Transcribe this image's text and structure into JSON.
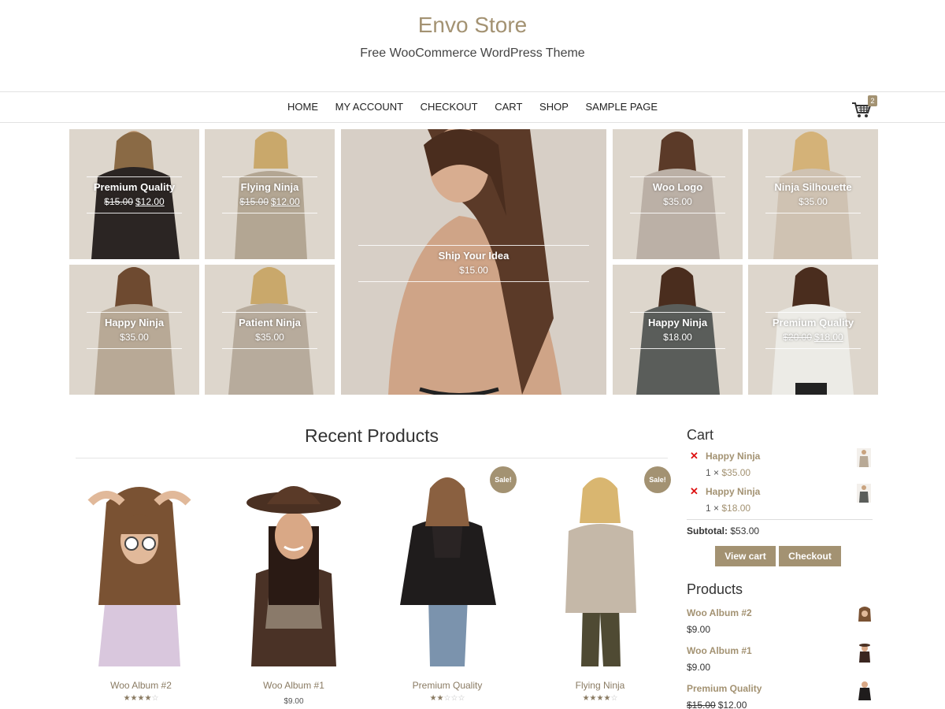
{
  "site": {
    "title": "Envo Store",
    "tagline": "Free WooCommerce WordPress Theme"
  },
  "nav": {
    "items": [
      "HOME",
      "MY ACCOUNT",
      "CHECKOUT",
      "CART",
      "SHOP",
      "SAMPLE PAGE"
    ],
    "cart_count": "2",
    "cart_icon": "shopping-cart-icon"
  },
  "grid": [
    {
      "name": "Premium Quality",
      "old_price": "$15.00",
      "price": "$12.00",
      "dark": true
    },
    {
      "name": "Flying Ninja",
      "old_price": "$15.00",
      "price": "$12.00"
    },
    {
      "name": "Ship Your Idea",
      "price": "$15.00"
    },
    {
      "name": "Woo Logo",
      "price": "$35.00"
    },
    {
      "name": "Ninja Silhouette",
      "price": "$35.00"
    },
    {
      "name": "Happy Ninja",
      "price": "$35.00"
    },
    {
      "name": "Patient Ninja",
      "price": "$35.00"
    },
    {
      "name": "Happy Ninja",
      "price": "$18.00",
      "dark": true
    },
    {
      "name": "Premium Quality",
      "old_price": "$20.00",
      "price": "$18.00"
    }
  ],
  "recent": {
    "title": "Recent Products",
    "products": [
      {
        "name": "Woo Album #2",
        "rating": 4,
        "sale": false
      },
      {
        "name": "Woo Album #1",
        "price": "$9.00",
        "sale": false
      },
      {
        "name": "Premium Quality",
        "rating": 2,
        "sale": true
      },
      {
        "name": "Flying Ninja",
        "rating": 4,
        "sale": true
      }
    ],
    "sale_label": "Sale!"
  },
  "cart_widget": {
    "title": "Cart",
    "items": [
      {
        "name": "Happy Ninja",
        "qty": "1 ×",
        "price": "$35.00"
      },
      {
        "name": "Happy Ninja",
        "qty": "1 ×",
        "price": "$18.00"
      }
    ],
    "subtotal_label": "Subtotal:",
    "subtotal": "$53.00",
    "view_cart": "View cart",
    "checkout": "Checkout"
  },
  "products_widget": {
    "title": "Products",
    "items": [
      {
        "name": "Woo Album #2",
        "price": "$9.00"
      },
      {
        "name": "Woo Album #1",
        "price": "$9.00"
      },
      {
        "name": "Premium Quality",
        "old_price": "$15.00",
        "price": "$12.00"
      }
    ]
  },
  "colors": {
    "accent": "#a39272",
    "tile_bg": "#ddd6cc",
    "remove": "#dd1111"
  }
}
